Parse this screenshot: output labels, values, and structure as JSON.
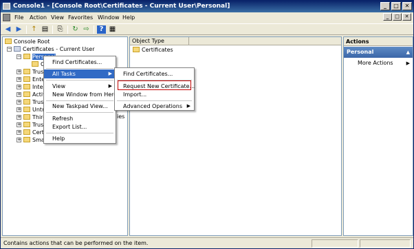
{
  "window": {
    "title": "Console1 - [Console Root\\Certificates - Current User\\Personal]",
    "min": "_",
    "max": "□",
    "close": "✕"
  },
  "menubar": {
    "items": [
      "File",
      "Action",
      "View",
      "Favorites",
      "Window",
      "Help"
    ]
  },
  "toolbar": {
    "back": "◀",
    "forward": "▶",
    "up": "↑",
    "tree": "▤",
    "copy": "⎘",
    "refresh": "↻",
    "export": "⇨",
    "help": "?",
    "console": "▦"
  },
  "tree": {
    "root": "Console Root",
    "certs": "Certificates - Current User",
    "personal": "Personal",
    "children": [
      "Trus",
      "Ente",
      "Inter",
      "Activ",
      "Trus",
      "Untr",
      "Thirc",
      "Trus",
      "Certi",
      "Smar"
    ],
    "personal_child": "C",
    "hidden_suffix": "ies"
  },
  "list": {
    "column_header": "Object Type",
    "items": [
      "Certificates"
    ]
  },
  "actions": {
    "header": "Actions",
    "section": "Personal",
    "more_actions": "More Actions"
  },
  "context_menu": {
    "items": [
      "Find Certificates...",
      "All Tasks",
      "View",
      "New Window from Here",
      "New Taskpad View...",
      "Refresh",
      "Export List...",
      "Help"
    ]
  },
  "submenu": {
    "items": [
      "Find Certificates...",
      "Request New Certificate...",
      "Import...",
      "Advanced Operations"
    ]
  },
  "status": {
    "text": "Contains actions that can be performed on the item."
  },
  "colors": {
    "highlight": "#316ac5",
    "title_bar": "#0a246a",
    "callout": "#c00000"
  }
}
